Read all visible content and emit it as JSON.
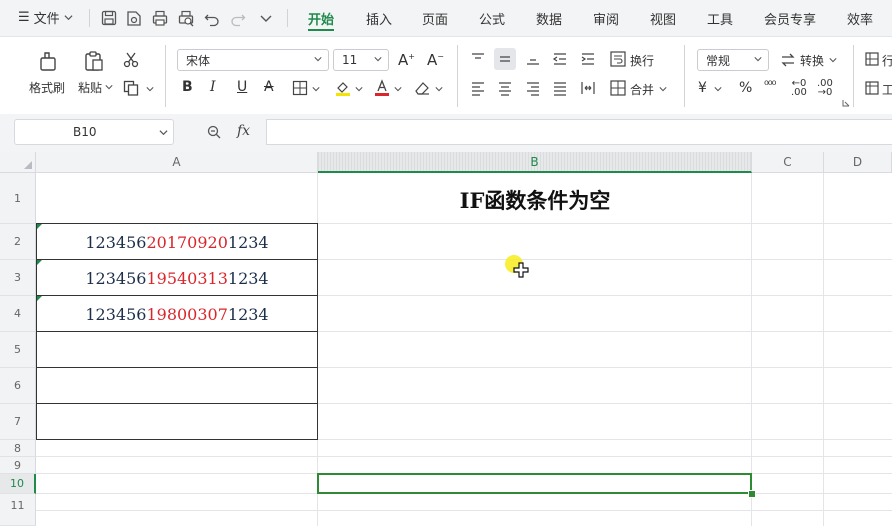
{
  "menu": {
    "file_label": "文件",
    "tabs": [
      "开始",
      "插入",
      "页面",
      "公式",
      "数据",
      "审阅",
      "视图",
      "工具",
      "会员专享",
      "效率"
    ],
    "active_tab": "开始"
  },
  "ribbon": {
    "format_painter": "格式刷",
    "paste": "粘贴",
    "font_name": "宋体",
    "font_size": "11",
    "wrap": "换行",
    "merge": "合并",
    "number_format": "常规",
    "convert": "转换",
    "rows_cols_partial": "行",
    "worksheet_partial": "工",
    "accent_color": "#1f8a4c"
  },
  "formula_bar": {
    "name_box": "B10",
    "fx": "fx",
    "formula": ""
  },
  "grid": {
    "columns": [
      "A",
      "B",
      "C",
      "D"
    ],
    "selected_column": "B",
    "rows": [
      "1",
      "2",
      "3",
      "4",
      "5",
      "6",
      "7",
      "8",
      "9",
      "10",
      "11"
    ],
    "selected_row": "10",
    "title": "IF函数条件为空",
    "id_numbers": [
      {
        "prefix": "123456",
        "date": "20170920",
        "suffix": "1234"
      },
      {
        "prefix": "123456",
        "date": "19540313",
        "suffix": "1234"
      },
      {
        "prefix": "123456",
        "date": "19800307",
        "suffix": "1234"
      }
    ]
  }
}
